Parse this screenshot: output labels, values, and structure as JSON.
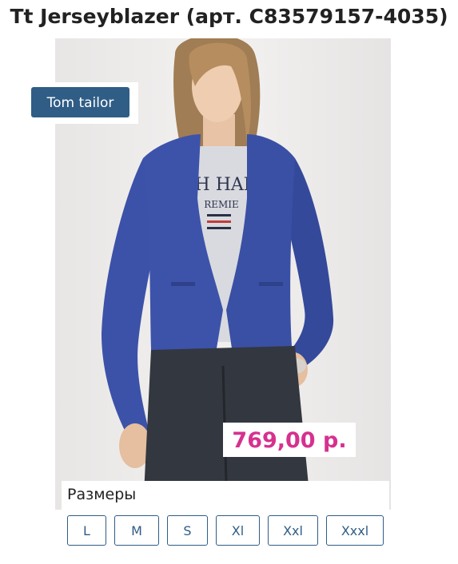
{
  "product": {
    "title": "Tt Jerseyblazer (арт. C83579157-4035)",
    "brand": "Tom tailor",
    "price": "769,00 р.",
    "image_alt": "Blue jersey blazer worn over printed t-shirt with dark jeans"
  },
  "sizes": {
    "label": "Размеры",
    "options": [
      "L",
      "M",
      "S",
      "Xl",
      "Xxl",
      "Xxxl"
    ]
  },
  "colors": {
    "brand_button": "#2f5d86",
    "price": "#d6318f",
    "blazer": "#3c52a8"
  }
}
